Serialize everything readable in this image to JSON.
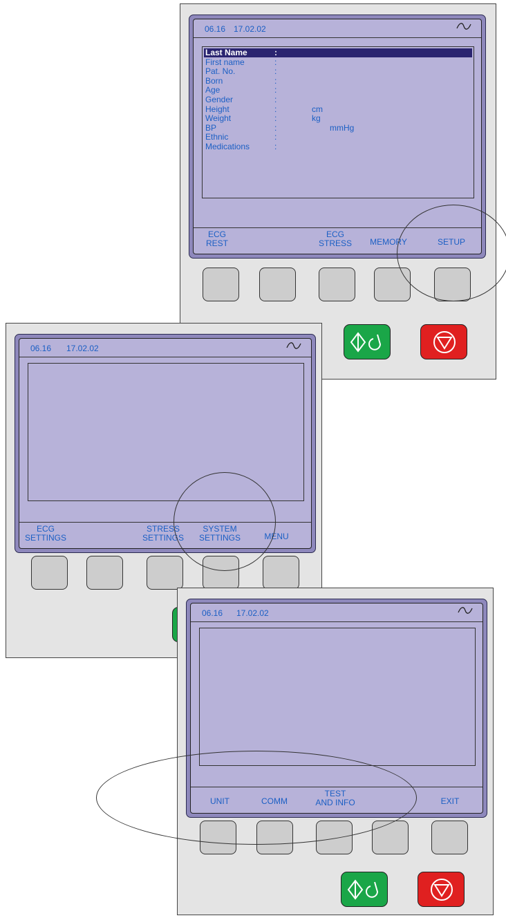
{
  "screen_header": {
    "time": "06.16",
    "date": "17.02.02",
    "signal_icon": "tilde-icon"
  },
  "panel_main": {
    "patient_fields": [
      {
        "label": "Last Name",
        "unit": "",
        "highlighted": true
      },
      {
        "label": "First name",
        "unit": ""
      },
      {
        "label": "Pat. No.",
        "unit": ""
      },
      {
        "label": "Born",
        "unit": ""
      },
      {
        "label": "Age",
        "unit": ""
      },
      {
        "label": "Gender",
        "unit": ""
      },
      {
        "label": "Height",
        "unit": "cm"
      },
      {
        "label": "Weight",
        "unit": "kg"
      },
      {
        "label": "BP",
        "unit": "mmHg"
      },
      {
        "label": "Ethnic",
        "unit": ""
      },
      {
        "label": "Medications",
        "unit": ""
      }
    ],
    "colon": ":",
    "softkeys": [
      "ECG\nREST",
      "",
      "ECG\nSTRESS",
      "MEMORY",
      "SETUP"
    ]
  },
  "panel_setup": {
    "softkeys": [
      "ECG\nSETTINGS",
      "",
      "STRESS\nSETTINGS",
      "SYSTEM\nSETTINGS",
      "MENU"
    ]
  },
  "panel_system": {
    "softkeys": [
      "UNIT",
      "COMM",
      "TEST\nAND INFO",
      "",
      "EXIT"
    ]
  },
  "hard_keys": {
    "start_icon": "start-diamond-icon",
    "stop_icon": "stop-triangle-icon"
  }
}
